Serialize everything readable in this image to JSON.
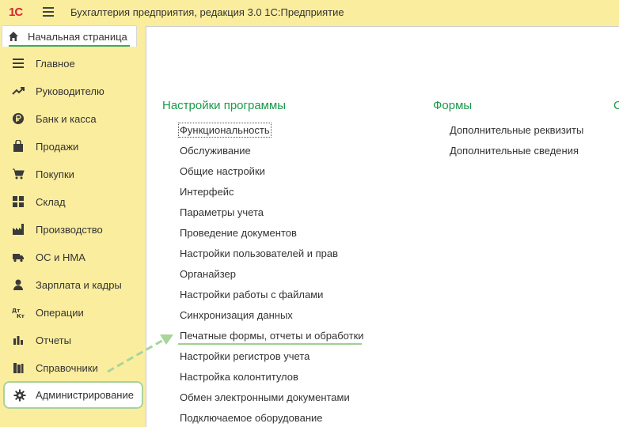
{
  "app": {
    "logo_main": "1С",
    "title": "Бухгалтерия предприятия, редакция 3.0 1С:Предприятие"
  },
  "tab": {
    "home_label": "Начальная страница"
  },
  "sidebar": {
    "items": [
      {
        "label": "Главное",
        "icon": "list-icon"
      },
      {
        "label": "Руководителю",
        "icon": "trend-icon"
      },
      {
        "label": "Банк и касса",
        "icon": "ruble-coin-icon"
      },
      {
        "label": "Продажи",
        "icon": "shopping-bag-icon"
      },
      {
        "label": "Покупки",
        "icon": "cart-icon"
      },
      {
        "label": "Склад",
        "icon": "warehouse-grid-icon"
      },
      {
        "label": "Производство",
        "icon": "factory-icon"
      },
      {
        "label": "ОС и НМА",
        "icon": "truck-icon"
      },
      {
        "label": "Зарплата и кадры",
        "icon": "person-icon"
      },
      {
        "label": "Операции",
        "icon": "debit-credit-icon"
      },
      {
        "label": "Отчеты",
        "icon": "bar-chart-icon"
      },
      {
        "label": "Справочники",
        "icon": "books-icon"
      },
      {
        "label": "Администрирование",
        "icon": "gear-icon"
      }
    ],
    "active": "Администрирование"
  },
  "main": {
    "section1": {
      "title": "Настройки программы",
      "links": [
        "Функциональность",
        "Обслуживание",
        "Общие настройки",
        "Интерфейс",
        "Параметры учета",
        "Проведение документов",
        "Настройки пользователей и прав",
        "Органайзер",
        "Настройки работы с файлами",
        "Синхронизация данных",
        "Печатные формы, отчеты и обработки",
        "Настройки регистров учета",
        "Настройка колонтитулов",
        "Обмен электронными документами",
        "Подключаемое оборудование"
      ],
      "focused": "Функциональность",
      "highlighted": "Печатные формы, отчеты и обработки"
    },
    "section2": {
      "title": "Формы",
      "links": [
        "Дополнительные реквизиты",
        "Дополнительные сведения"
      ]
    },
    "section3": {
      "title": "С"
    }
  },
  "colors": {
    "accent": "#1a9a4a",
    "sidebar_bg": "#fbed9e",
    "highlight": "#9fcf8e"
  }
}
